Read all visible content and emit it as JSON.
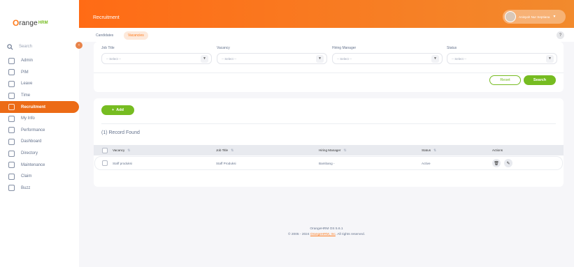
{
  "brand": {
    "orange": "O",
    "name": "range",
    "hrm": "HRM"
  },
  "sidebar": {
    "search_label": "Search",
    "items": [
      {
        "label": "Admin",
        "icon": "admin-icon"
      },
      {
        "label": "PIM",
        "icon": "pim-icon"
      },
      {
        "label": "Leave",
        "icon": "leave-icon"
      },
      {
        "label": "Time",
        "icon": "time-icon"
      },
      {
        "label": "Recruitment",
        "icon": "recruitment-icon",
        "active": true
      },
      {
        "label": "My Info",
        "icon": "myinfo-icon"
      },
      {
        "label": "Performance",
        "icon": "performance-icon"
      },
      {
        "label": "Dashboard",
        "icon": "dashboard-icon"
      },
      {
        "label": "Directory",
        "icon": "directory-icon"
      },
      {
        "label": "Maintenance",
        "icon": "maintenance-icon"
      },
      {
        "label": "Claim",
        "icon": "claim-icon"
      },
      {
        "label": "Buzz",
        "icon": "buzz-icon"
      }
    ]
  },
  "header": {
    "title": "Recruitment",
    "user_name": "Anisyah Nur Septiana",
    "tabs": {
      "candidates": "Candidates",
      "vacancies": "Vacancies"
    },
    "help": "?"
  },
  "filters": {
    "job_title": {
      "label": "Job Title",
      "value": "-- Select --"
    },
    "vacancy": {
      "label": "Vacancy",
      "value": "-- Select --"
    },
    "hiring_manager": {
      "label": "Hiring Manager",
      "value": "-- Select --"
    },
    "status": {
      "label": "Status",
      "value": "-- Select --"
    },
    "reset_label": "Reset",
    "search_label": "Search"
  },
  "results": {
    "add_label": "Add",
    "record_count": "(1) Record Found",
    "columns": [
      "Vacancy",
      "Job Title",
      "Hiring Manager",
      "Status",
      "Actions"
    ],
    "rows": [
      {
        "vacancy": "Staff produksi",
        "job_title": "Staff Produksi",
        "hiring_manager": "Bambang -",
        "status": "Active"
      }
    ]
  },
  "footer": {
    "version": "OrangeHRM OS 5.6.1",
    "copyright_prefix": "© 2005 - 2024",
    "company_link": "OrangeHRM, Inc",
    "copyright_suffix": ". All rights reserved."
  },
  "colors": {
    "accent": "#ff7b1d",
    "green": "#76bc21",
    "active_nav": "#ec6b16"
  }
}
